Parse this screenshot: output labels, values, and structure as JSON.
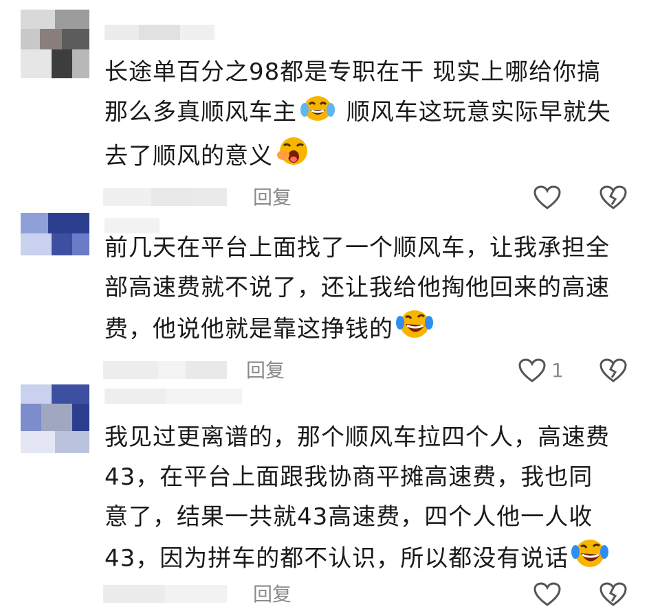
{
  "comments": [
    {
      "text_lines": [
        "长途单百分之98都是专职在干 现实上哪给你搞",
        "那么多真顺风车主",
        "顺风车这玩意实际早就失",
        "去了顺风的意义"
      ],
      "emojis": [
        "tears-of-joy-emoji",
        "crying-face-emoji"
      ],
      "reply_label": "回复",
      "like_count": ""
    },
    {
      "text_lines": [
        "前几天在平台上面找了一个顺风车，让我承担全",
        "部高速费就不说了，还让我给他掏他回来的高速",
        "费，他说他就是靠这挣钱的"
      ],
      "emojis": [
        "rolling-laughing-emoji"
      ],
      "reply_label": "回复",
      "like_count": "1"
    },
    {
      "text_lines": [
        "我见过更离谱的，那个顺风车拉四个人，高速费",
        "43，在平台上面跟我协商平摊高速费，我也同",
        "意了，结果一共就43高速费，四个人他一人收",
        "43，因为拼车的都不认识，所以都没有说话"
      ],
      "emojis": [
        "rolling-laughing-emoji"
      ],
      "reply_label": "回复",
      "like_count": ""
    }
  ],
  "icons": {
    "like": "heart-outline-icon",
    "dislike": "broken-heart-outline-icon"
  },
  "colors": {
    "text": "#1a1a1a",
    "meta": "#8a8a8a"
  }
}
